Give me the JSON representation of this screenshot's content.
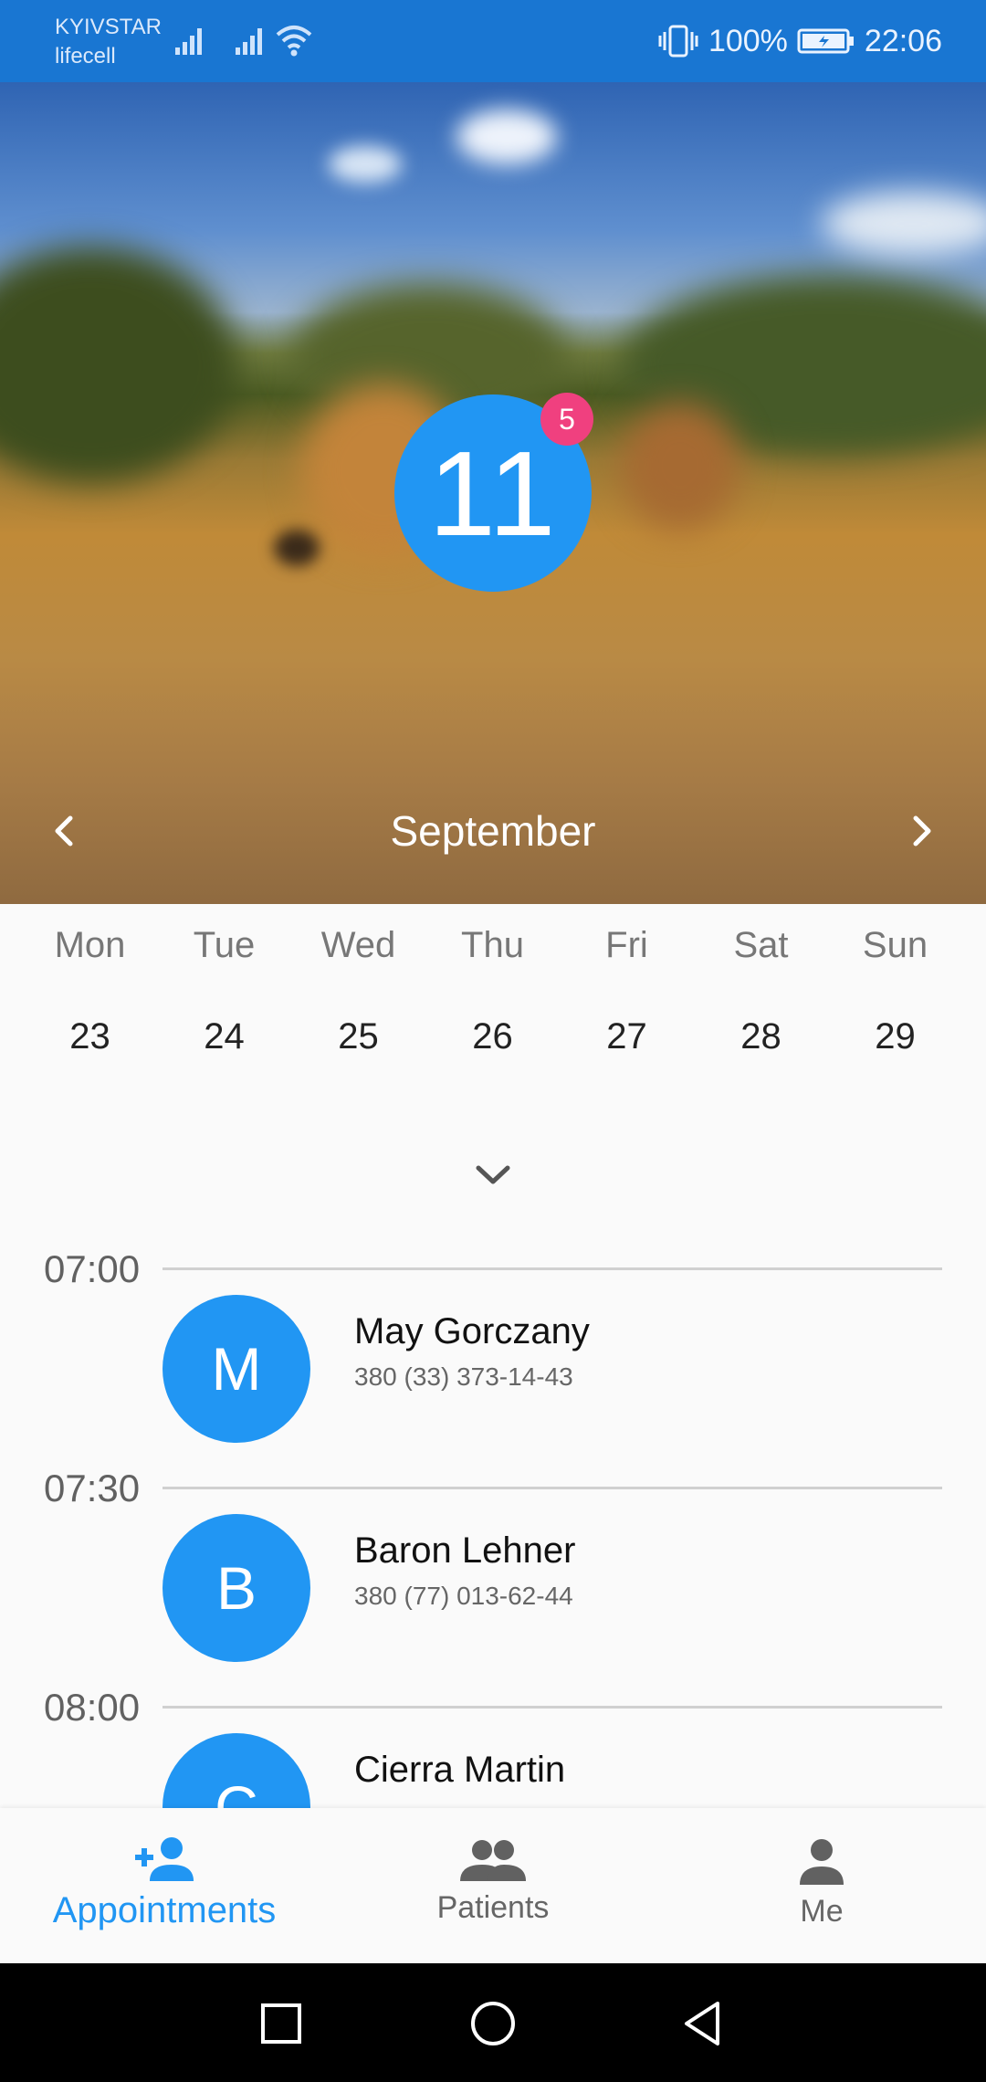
{
  "status_bar": {
    "carrier1": "KYIVSTAR",
    "carrier2": "lifecell",
    "battery": "100%",
    "time": "22:06",
    "icons": [
      "signal-icon",
      "signal-icon",
      "wifi-icon",
      "vibrate-icon",
      "battery-icon"
    ]
  },
  "hero": {
    "day": "11",
    "badge_count": "5",
    "month": "September"
  },
  "week": {
    "days": [
      "Mon",
      "Tue",
      "Wed",
      "Thu",
      "Fri",
      "Sat",
      "Sun"
    ],
    "dates": [
      "23",
      "24",
      "25",
      "26",
      "27",
      "28",
      "29"
    ]
  },
  "schedule": [
    {
      "time": "07:00",
      "initial": "M",
      "name": "May Gorczany",
      "phone": "380 (33) 373-14-43"
    },
    {
      "time": "07:30",
      "initial": "B",
      "name": "Baron Lehner",
      "phone": "380 (77) 013-62-44"
    },
    {
      "time": "08:00",
      "initial": "C",
      "name": "Cierra Martin",
      "phone": ""
    }
  ],
  "bottom_nav": {
    "appointments": "Appointments",
    "patients": "Patients",
    "me": "Me"
  },
  "colors": {
    "primary": "#2196f3",
    "status_bar": "#1976d2",
    "badge": "#f0407f"
  }
}
